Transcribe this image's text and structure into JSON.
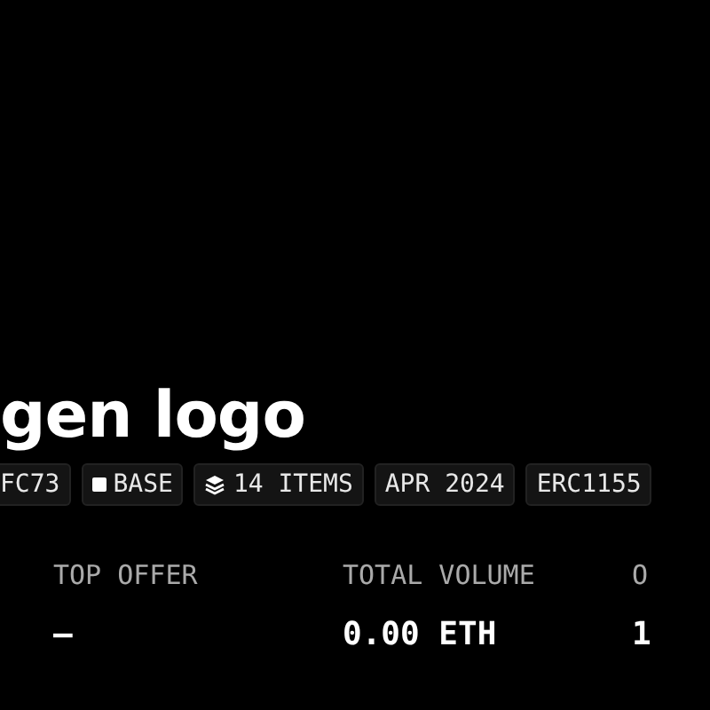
{
  "title": "gen logo",
  "tags": [
    {
      "kind": "plain",
      "label": "FC73"
    },
    {
      "kind": "chain",
      "label": "BASE"
    },
    {
      "kind": "items",
      "label": "14 ITEMS"
    },
    {
      "kind": "plain",
      "label": "APR 2024"
    },
    {
      "kind": "plain",
      "label": "ERC1155"
    }
  ],
  "stats": [
    {
      "label": "TOP OFFER",
      "value": "–"
    },
    {
      "label": "TOTAL VOLUME",
      "value": "0.00 ETH"
    },
    {
      "label": "O",
      "value": "1"
    }
  ]
}
